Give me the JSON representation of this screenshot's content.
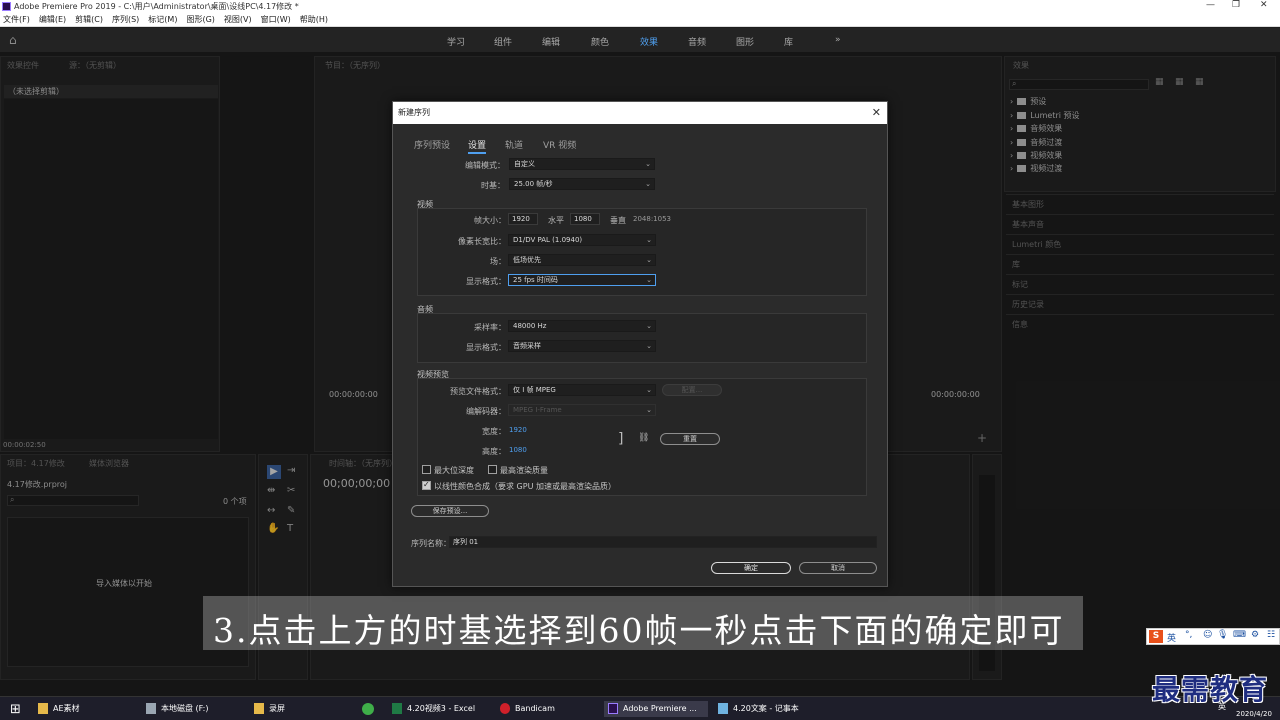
{
  "window": {
    "title": "Adobe Premiere Pro 2019 - C:\\用户\\Administrator\\桌面\\设线PC\\4.17修改 *"
  },
  "menu": [
    "文件(F)",
    "编辑(E)",
    "剪辑(C)",
    "序列(S)",
    "标记(M)",
    "图形(G)",
    "视图(V)",
    "窗口(W)",
    "帮助(H)"
  ],
  "workspaces": [
    "学习",
    "组件",
    "编辑",
    "颜色",
    "效果",
    "音频",
    "图形",
    "库",
    "»"
  ],
  "workspace_active": "效果",
  "panels": {
    "effect_controls": "效果控件",
    "source": "源：（无剪辑）",
    "no_clip": "（未选择剪辑）",
    "program": "节目：（无序列）",
    "timecode_left": "00:00:00:00",
    "timecode_right": "00:00:00:00",
    "timecode_source": "00:00:02:50",
    "project": "项目：4.17修改",
    "media_browser": "媒体浏览器",
    "project_file": "4.17修改.prproj",
    "item_count": "0 个项",
    "import_hint": "导入媒体以开始",
    "timeline": "时间轴：（无序列）",
    "timeline_tc": "00;00;00;00",
    "effects": "效果"
  },
  "effects_tree": [
    "预设",
    "Lumetri 预设",
    "音频效果",
    "音频过渡",
    "视频效果",
    "视频过渡"
  ],
  "side_panels": [
    "基本图形",
    "基本声音",
    "Lumetri 颜色",
    "库",
    "标记",
    "历史记录",
    "信息"
  ],
  "dialog": {
    "title": "新建序列",
    "tabs": [
      "序列预设",
      "设置",
      "轨道",
      "VR 视频"
    ],
    "active_tab": "设置",
    "edit_mode_label": "编辑模式：",
    "edit_mode_value": "自定义",
    "timebase_label": "时基：",
    "timebase_value": "25.00  帧/秒",
    "video_group": "视频",
    "frame_size_label": "帧大小：",
    "frame_width": "1920",
    "horizontal_label": "水平",
    "frame_height": "1080",
    "vertical_label": "垂直",
    "aspect": "2048:1053",
    "pixel_aspect_label": "像素长宽比：",
    "pixel_aspect_value": "D1/DV PAL (1.0940)",
    "field_label": "场：",
    "field_value": "低场优先",
    "display_format_label": "显示格式：",
    "display_format_value": "25 fps 时间码",
    "audio_group": "音频",
    "sample_rate_label": "采样率：",
    "sample_rate_value": "48000 Hz",
    "audio_display_label": "显示格式：",
    "audio_display_value": "音频采样",
    "preview_group": "视频预览",
    "preview_format_label": "预览文件格式：",
    "preview_format_value": "仅 I 帧 MPEG",
    "configure_button": "配置...",
    "codec_label": "编解码器：",
    "codec_value": "MPEG I-Frame",
    "width_label": "宽度：",
    "width_value": "1920",
    "height_label": "高度：",
    "height_value": "1080",
    "reset_button": "重置",
    "max_depth": "最大位深度",
    "max_quality": "最高渲染质量",
    "linear_color": "以线性颜色合成（要求 GPU 加速或最高渲染品质）",
    "save_preset_button": "保存预设...",
    "sequence_name_label": "序列名称：",
    "sequence_name_value": "序列 01",
    "ok_button": "确定",
    "cancel_button": "取消"
  },
  "caption": "3.点击上方的时基选择到60帧一秒点击下面的确定即可",
  "taskbar": {
    "items": [
      "AE素材",
      "本地磁盘 (F:)",
      "录屏",
      "4.20视频3 - Excel",
      "Bandicam",
      "Adobe Premiere ...",
      "4.20文案 - 记事本"
    ],
    "lang": "英",
    "date": "2020/4/20"
  },
  "watermark": "最需教育",
  "colors": {
    "accent": "#4f9fef",
    "panel_bg": "#232323",
    "dialog_bg": "#2b2b2b"
  }
}
